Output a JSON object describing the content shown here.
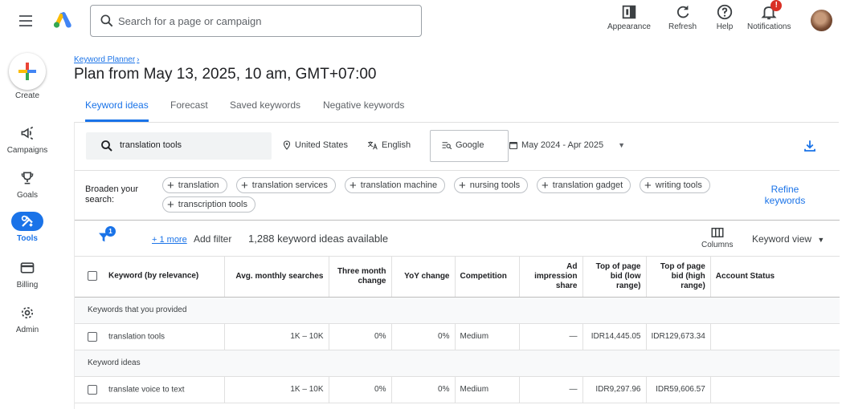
{
  "topbar": {
    "search_placeholder": "Search for a page or campaign",
    "appearance": "Appearance",
    "refresh": "Refresh",
    "help": "Help",
    "notifications": "Notifications",
    "notification_badge": "!"
  },
  "nav": {
    "create": "Create",
    "campaigns": "Campaigns",
    "goals": "Goals",
    "tools": "Tools",
    "billing": "Billing",
    "admin": "Admin"
  },
  "breadcrumb": "Keyword Planner",
  "page_title": "Plan from May 13, 2025, 10 am, GMT+07:00",
  "tabs": [
    "Keyword ideas",
    "Forecast",
    "Saved keywords",
    "Negative keywords"
  ],
  "filters": {
    "query": "translation tools",
    "location": "United States",
    "language": "English",
    "network": "Google",
    "date_range": "May 2024 - Apr 2025"
  },
  "broaden": {
    "label": "Broaden your search:",
    "chips": [
      "translation",
      "translation services",
      "translation machine",
      "nursing tools",
      "translation gadget",
      "writing tools",
      "transcription tools"
    ],
    "refine": "Refine keywords"
  },
  "toolbar": {
    "filter_badge": "1",
    "more": "+ 1 more",
    "add_filter": "Add filter",
    "count": "1,288 keyword ideas available",
    "columns": "Columns",
    "view": "Keyword view"
  },
  "table": {
    "headers": [
      "Keyword (by relevance)",
      "Avg. monthly searches",
      "Three month change",
      "YoY change",
      "Competition",
      "Ad impression share",
      "Top of page bid (low range)",
      "Top of page bid (high range)",
      "Account Status"
    ],
    "group_provided": "Keywords that you provided",
    "group_ideas": "Keyword ideas",
    "rows": [
      [
        "translation tools",
        "1K – 10K",
        "0%",
        "0%",
        "Medium",
        "—",
        "IDR14,445.05",
        "IDR129,673.34",
        ""
      ],
      [
        "translate voice to text",
        "1K – 10K",
        "0%",
        "0%",
        "Medium",
        "—",
        "IDR9,297.96",
        "IDR59,606.57",
        ""
      ]
    ]
  },
  "colors": {
    "accent": "#1a73e8",
    "text": "#202124",
    "muted": "#5f6368",
    "border": "#e0e0e0"
  }
}
